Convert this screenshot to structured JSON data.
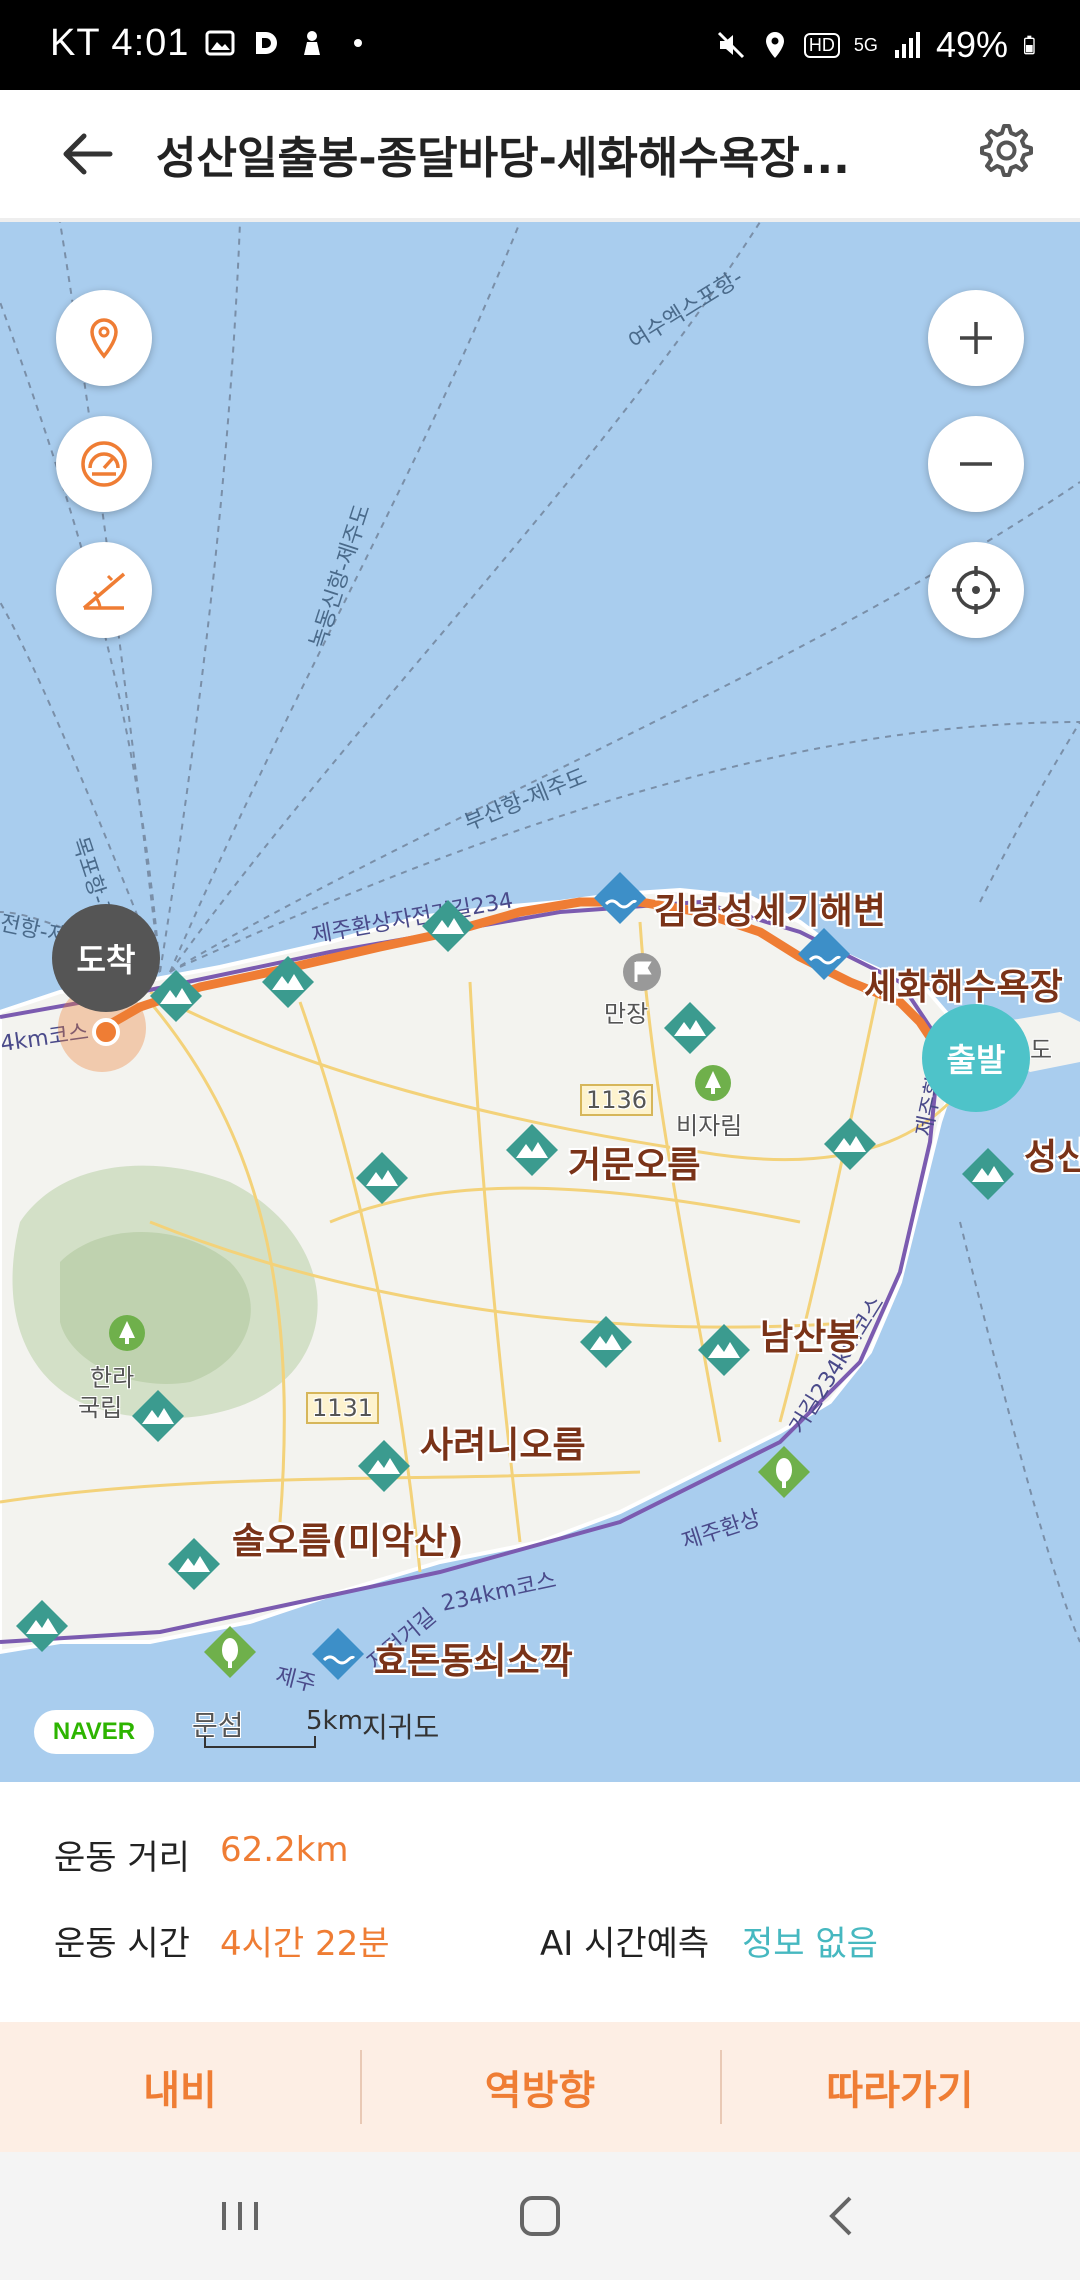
{
  "status_bar": {
    "time": "KT 4:01",
    "network": "5G",
    "hd": "HD",
    "battery": "49%"
  },
  "header": {
    "title": "성산일출봉-종달바당-세화해수욕장...",
    "back_icon": "back-arrow-icon",
    "settings_icon": "gear-icon"
  },
  "map": {
    "controls_left": [
      "location-pin-icon",
      "speedometer-icon",
      "slope-icon"
    ],
    "controls_right": [
      "zoom-in-icon",
      "zoom-out-icon",
      "crosshair-icon"
    ],
    "markers": {
      "end": "도착",
      "start": "출발"
    },
    "poi_labels": {
      "gimnyeong": "김녕성세기해변",
      "sehwa": "세화해수욕장",
      "geomun": "거문오름",
      "seongsan": "성산",
      "namsan": "남산봉",
      "saryeoni": "사려니오름",
      "solorum": "솔오름(미악산)",
      "hyodon": "효돈동쇠소깍"
    },
    "small_labels": {
      "manjang": "만장",
      "bijarim": "비자림",
      "hanra": "한라",
      "gungnip": "국립",
      "road_1136": "1136",
      "road_1131": "1131",
      "udo": "도",
      "munseom": "문섬",
      "jigwido": "지귀도",
      "mokpo_cut": "전항-제"
    },
    "ferry_routes": {
      "yeosu": "여수엑스포항-",
      "nokdong": "녹동신항-제주도",
      "busan": "부산항-제주도",
      "mokpo": "목포항-제주도"
    },
    "route_labels": {
      "jeju_geo": "제주환상자전거길234",
      "left_km": "4km코스",
      "right": "거길234km코스",
      "right2": "제주환상",
      "south": "234km코스",
      "south2": "자전거길",
      "south3": "제주",
      "left2": "제주환"
    },
    "brand": "NAVER",
    "scale_label": "5km"
  },
  "stats": {
    "distance_label": "운동 거리",
    "distance_value": "62.2km",
    "time_label": "운동 시간",
    "time_value": "4시간 22분",
    "ai_label": "AI 시간예측",
    "ai_value": "정보 없음"
  },
  "actions": {
    "navi": "내비",
    "reverse": "역방향",
    "follow": "따라가기"
  },
  "nav_bar": [
    "recents-icon",
    "home-icon",
    "back-icon"
  ],
  "colors": {
    "accent": "#ef7d34",
    "teal": "#46b8c0",
    "sea": "#a9cdee",
    "land": "#f3f3ef",
    "route": "#ef7d34"
  }
}
